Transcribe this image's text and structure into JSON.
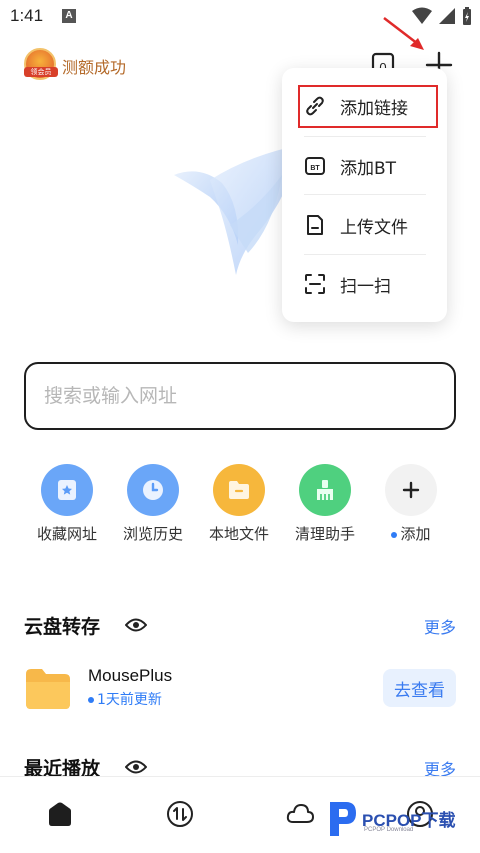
{
  "status_bar": {
    "time": "1:41",
    "notif_letter": "A"
  },
  "header": {
    "vip_badge_text": "领会员",
    "vip_text": "测额成功",
    "box_count": "0"
  },
  "popup_menu": {
    "items": [
      {
        "label": "添加链接",
        "icon": "link-icon",
        "highlighted": true
      },
      {
        "label": "添加BT",
        "icon": "bt-icon",
        "icon_text": "BT"
      },
      {
        "label": "上传文件",
        "icon": "file-icon"
      },
      {
        "label": "扫一扫",
        "icon": "scan-icon"
      }
    ]
  },
  "search": {
    "placeholder": "搜索或输入网址",
    "value": ""
  },
  "shortcuts": [
    {
      "label": "收藏网址",
      "icon": "star-bookmark-icon",
      "color": "#5b9cf8"
    },
    {
      "label": "浏览历史",
      "icon": "clock-icon",
      "color": "#5b9cf8"
    },
    {
      "label": "本地文件",
      "icon": "folder-icon",
      "color": "#f6b73c"
    },
    {
      "label": "清理助手",
      "icon": "broom-icon",
      "color": "#4fd07f"
    },
    {
      "label": "添加",
      "icon": "plus-icon",
      "color": "#f2f2f2",
      "has_dot": true
    }
  ],
  "cloud_section": {
    "title": "云盘转存",
    "more": "更多",
    "item": {
      "name": "MousePlus",
      "sub": "1天前更新",
      "action": "去查看"
    }
  },
  "recent_section": {
    "title": "最近播放",
    "more": "更多"
  },
  "bottom_nav": [
    {
      "icon": "home-icon"
    },
    {
      "icon": "transfer-icon"
    },
    {
      "icon": "cloud-icon"
    },
    {
      "icon": "profile-icon"
    }
  ],
  "watermark": {
    "text": "PCPOP下载",
    "sub": "PCPOP Download"
  },
  "colors": {
    "accent": "#3a7bf0",
    "highlight": "#e02a2a",
    "vip": "#b46a2a"
  }
}
